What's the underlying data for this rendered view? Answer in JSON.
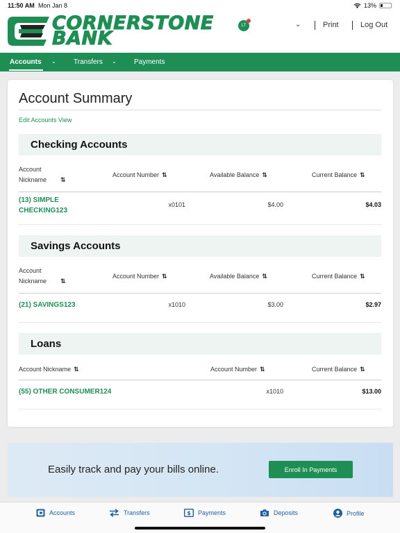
{
  "status_bar": {
    "time": "11:50 AM",
    "date": "Mon Jan 8",
    "battery": "13%"
  },
  "header": {
    "logo_line1": "CORNERSTONE",
    "logo_line2": "BANK",
    "avatar_initials": "LT",
    "print_label": "Print",
    "logout_label": "Log Out"
  },
  "nav": {
    "accounts": "Accounts",
    "transfers": "Transfers",
    "payments": "Payments"
  },
  "summary": {
    "title": "Account Summary",
    "edit_link": "Edit Accounts View"
  },
  "checking": {
    "heading": "Checking Accounts",
    "col_nickname_1": "Account",
    "col_nickname_2": "Nickname",
    "col_number": "Account Number",
    "col_available": "Available Balance",
    "col_current": "Current Balance",
    "rows": [
      {
        "name_1": "(13) SIMPLE",
        "name_2": "CHECKING123",
        "number": "x0101",
        "available": "$4.00",
        "current": "$4.03"
      }
    ]
  },
  "savings": {
    "heading": "Savings Accounts",
    "col_nickname_1": "Account",
    "col_nickname_2": "Nickname",
    "col_number": "Account Number",
    "col_available": "Available Balance",
    "col_current": "Current Balance",
    "rows": [
      {
        "name": "(21) SAVINGS123",
        "number": "x1010",
        "available": "$3.00",
        "current": "$2.97"
      }
    ]
  },
  "loans": {
    "heading": "Loans",
    "col_nickname": "Account Nickname",
    "col_number": "Account Number",
    "col_current": "Current Balance",
    "rows": [
      {
        "name": "(55) OTHER CONSUMER124",
        "number": "x1010",
        "current": "$13.00"
      }
    ]
  },
  "banner": {
    "text": "Easily track and pay your bills online.",
    "button": "Enroll In Payments"
  },
  "tabbar": {
    "accounts": "Accounts",
    "transfers": "Transfers",
    "payments": "Payments",
    "deposits": "Deposits",
    "profile": "Profile"
  },
  "colors": {
    "brand_green": "#1e8e55",
    "tab_blue": "#1f5f9e",
    "section_bg": "#eef4f1"
  }
}
